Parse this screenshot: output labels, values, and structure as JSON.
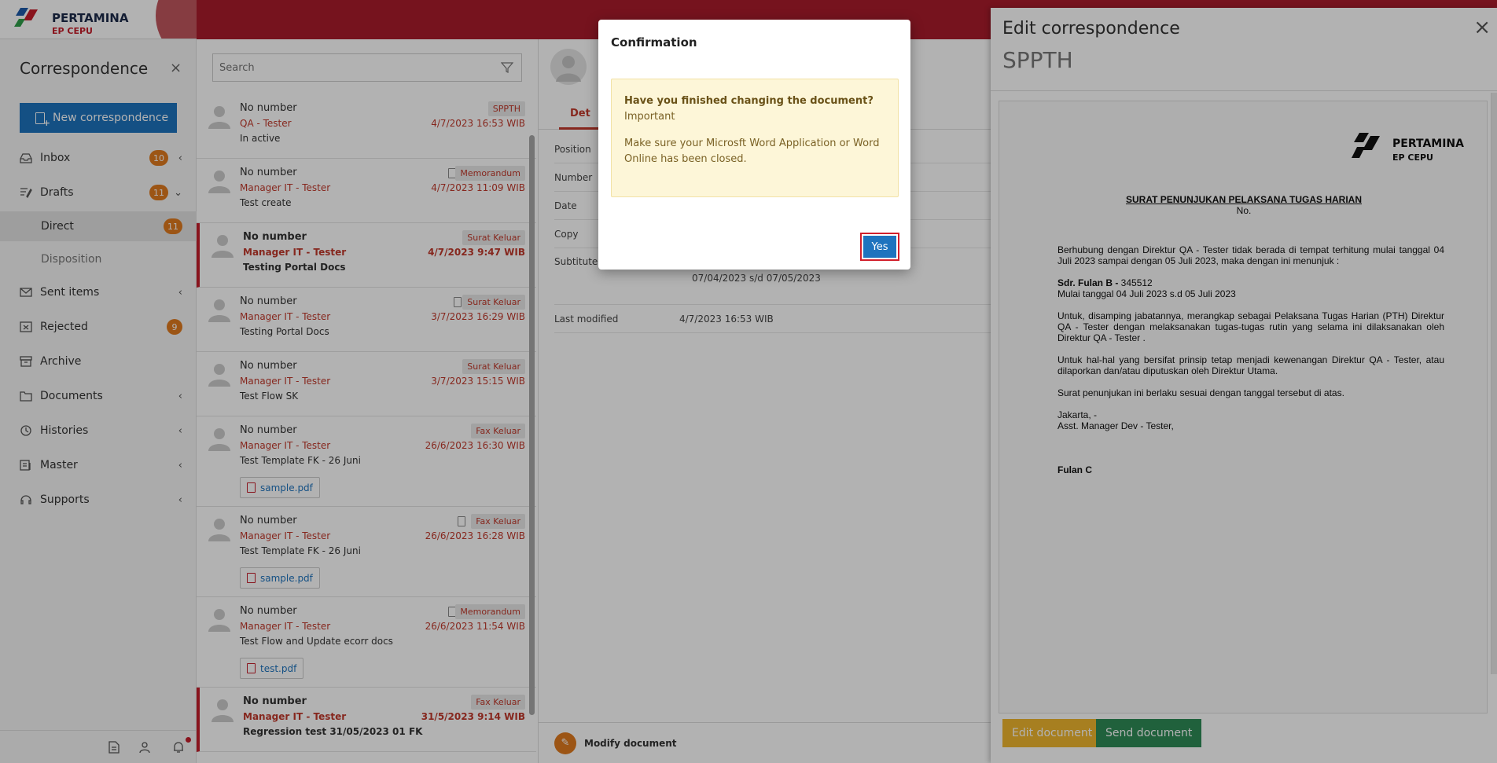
{
  "brand": {
    "name": "PERTAMINA",
    "sub": "EP CEPU"
  },
  "sidebar": {
    "title": "Correspondence",
    "close": "×",
    "new_button": "New correspondence",
    "items": [
      {
        "label": "Inbox",
        "badge": "10",
        "chevron": "‹"
      },
      {
        "label": "Drafts",
        "badge": "11",
        "chevron": "⌄"
      },
      {
        "label": "Direct",
        "badge": "11"
      },
      {
        "label": "Disposition"
      },
      {
        "label": "Sent items",
        "chevron": "‹"
      },
      {
        "label": "Rejected",
        "badge": "9"
      },
      {
        "label": "Archive"
      },
      {
        "label": "Documents",
        "chevron": "‹"
      },
      {
        "label": "Histories",
        "chevron": "‹"
      },
      {
        "label": "Master",
        "chevron": "‹"
      },
      {
        "label": "Supports",
        "chevron": "‹"
      }
    ]
  },
  "search": {
    "placeholder": "Search"
  },
  "list": [
    {
      "number": "No number",
      "sender": "QA - Tester",
      "subject": "In active",
      "tag": "SPPTH",
      "time": "4/7/2023 16:53 WIB"
    },
    {
      "number": "No number",
      "sender": "Manager IT - Tester",
      "subject": "Test create",
      "tag": "Memorandum",
      "time": "4/7/2023 11:09 WIB"
    },
    {
      "number": "No number",
      "sender": "Manager IT - Tester",
      "subject": "Testing Portal Docs",
      "tag": "Surat Keluar",
      "time": "4/7/2023 9:47 WIB"
    },
    {
      "number": "No number",
      "sender": "Manager IT - Tester",
      "subject": "Testing Portal Docs",
      "tag": "Surat Keluar",
      "time": "3/7/2023 16:29 WIB"
    },
    {
      "number": "No number",
      "sender": "Manager IT - Tester",
      "subject": "Test Flow SK",
      "tag": "Surat Keluar",
      "time": "3/7/2023 15:15 WIB"
    },
    {
      "number": "No number",
      "sender": "Manager IT - Tester",
      "subject": "Test Template FK - 26 Juni",
      "tag": "Fax Keluar",
      "time": "26/6/2023 16:30 WIB",
      "attachment": "sample.pdf"
    },
    {
      "number": "No number",
      "sender": "Manager IT - Tester",
      "subject": "Test Template FK - 26 Juni",
      "tag": "Fax Keluar",
      "time": "26/6/2023 16:28 WIB",
      "attachment": "sample.pdf"
    },
    {
      "number": "No number",
      "sender": "Manager IT - Tester",
      "subject": "Test Flow and Update ecorr docs",
      "tag": "Memorandum",
      "time": "26/6/2023 11:54 WIB",
      "attachment": "test.pdf"
    },
    {
      "number": "No number",
      "sender": "Manager IT - Tester",
      "subject": "Regression test 31/05/2023 01 FK",
      "tag": "Fax Keluar",
      "time": "31/5/2023 9:14 WIB"
    }
  ],
  "detail": {
    "tab": "Det",
    "rows": [
      {
        "label": "Position"
      },
      {
        "label": "Number"
      },
      {
        "label": "Date"
      },
      {
        "label": "Copy"
      },
      {
        "label": "Subtitute",
        "value": "07/04/2023 s/d 07/05/2023"
      },
      {
        "label": "Last modified",
        "value": "4/7/2023 16:53 WIB"
      }
    ],
    "modify_label": "Modify document"
  },
  "edit_panel": {
    "title": "Edit correspondence",
    "type": "SPPTH",
    "close": "×",
    "edit_button": "Edit document",
    "send_button": "Send document",
    "document": {
      "title": "SURAT PENUNJUKAN PELAKSANA TUGAS HARIAN",
      "no": "No.",
      "p1": "Berhubung dengan Direktur QA - Tester tidak berada di tempat terhitung mulai tanggal 04 Juli 2023 sampai dengan 05 Juli 2023, maka dengan ini menunjuk :",
      "name_bold": "Sdr. Fulan B -",
      "name_id": " 345512",
      "p2": "Mulai tanggal 04 Juli 2023 s.d 05 Juli 2023",
      "p3": "Untuk, disamping jabatannya, merangkap sebagai Pelaksana Tugas Harian (PTH) Direktur QA - Tester dengan melaksanakan tugas-tugas rutin yang selama ini dilaksanakan oleh Direktur QA - Tester .",
      "p4": "Untuk hal-hal yang bersifat prinsip tetap menjadi kewenangan Direktur QA - Tester, atau dilaporkan dan/atau diputuskan oleh Direktur Utama.",
      "p5": "Surat penunjukan ini berlaku sesuai dengan tanggal tersebut di atas.",
      "place": "Jakarta, -",
      "role": "Asst. Manager Dev - Tester,",
      "signer": "Fulan C"
    }
  },
  "modal": {
    "title": "Confirmation",
    "question": "Have you finished changing the document?",
    "importance": "Important",
    "message": "Make sure your Microsft Word Application or Word Online has been closed.",
    "yes": "Yes"
  },
  "colors": {
    "brand_red": "#a91c2b",
    "primary_blue": "#1e73be",
    "badge_orange": "#e07a1f",
    "warning_bg": "#fdf6d8",
    "send_green": "#2e8b57",
    "edit_yellow": "#f0b72f"
  }
}
